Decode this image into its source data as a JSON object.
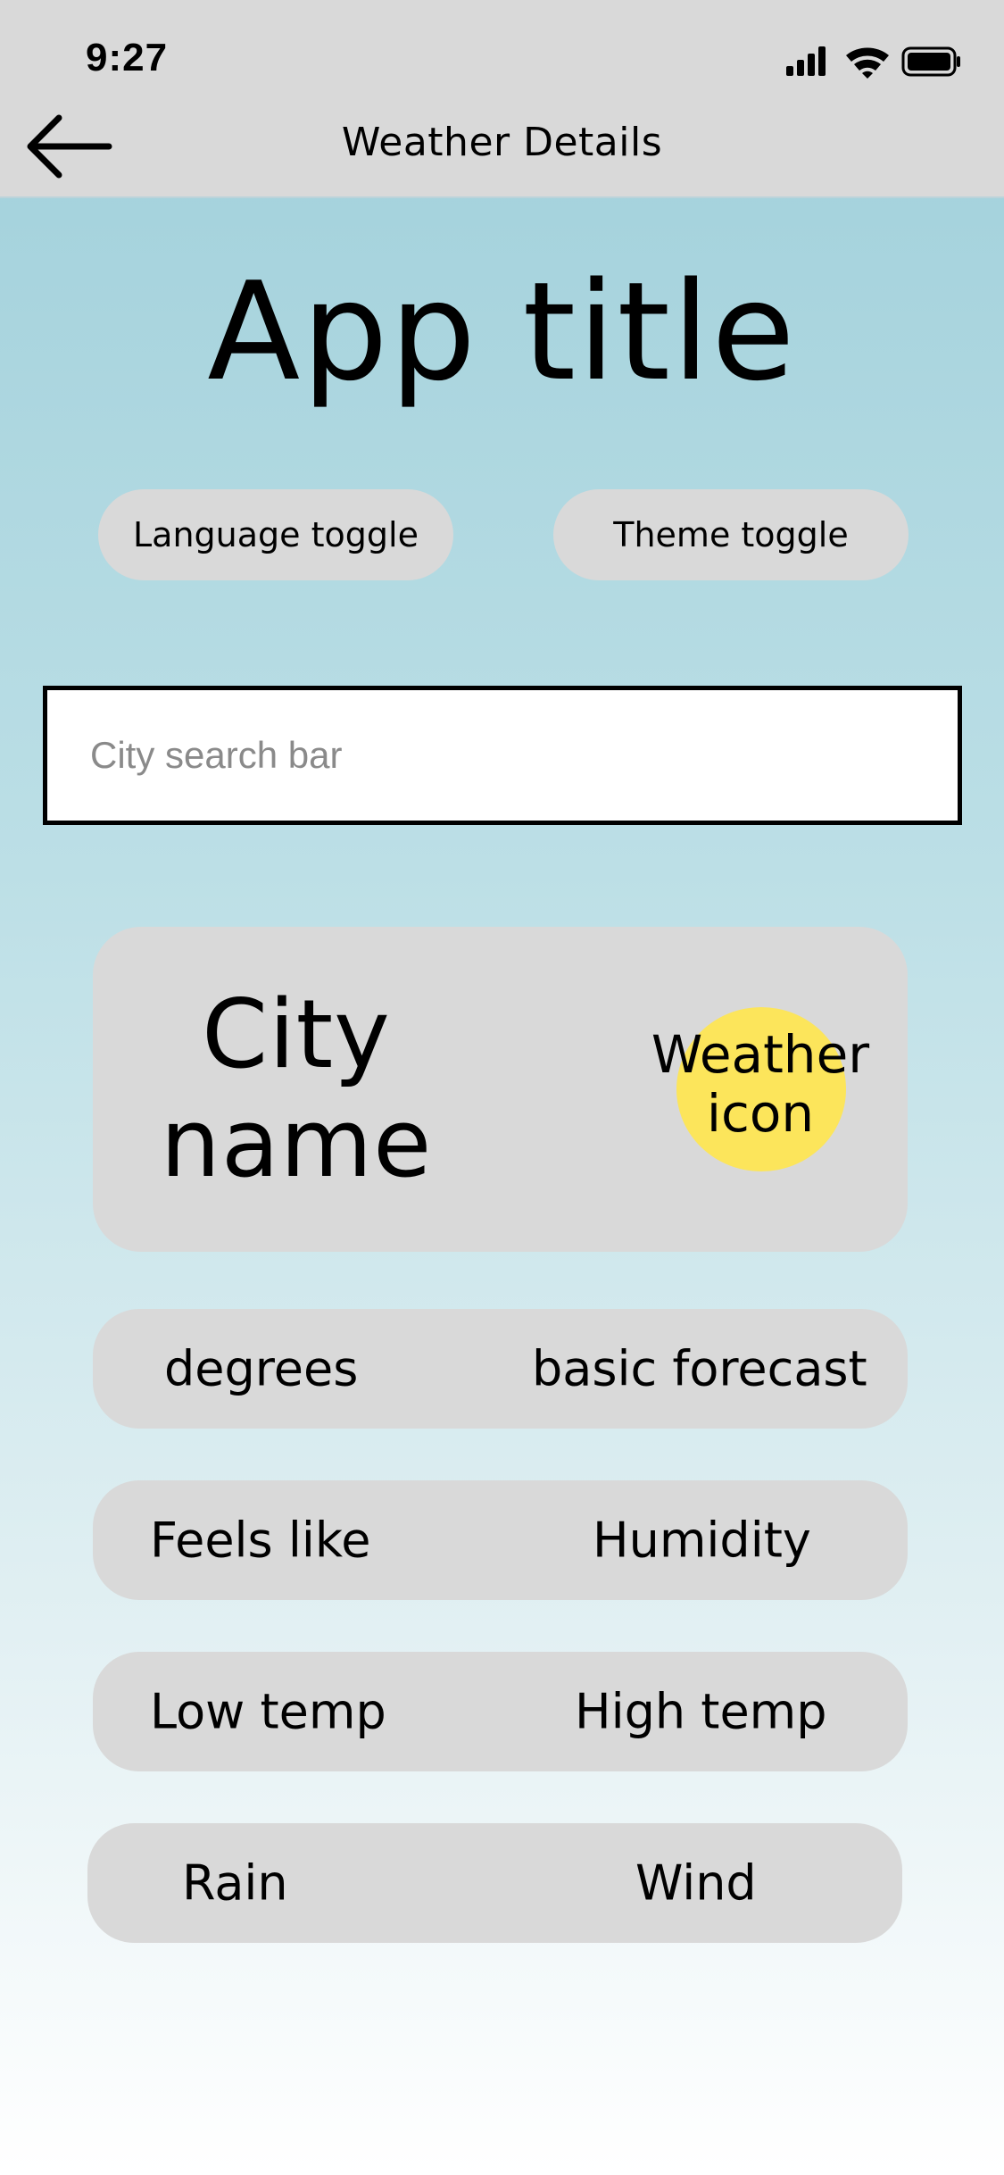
{
  "status_bar": {
    "time": "9:27"
  },
  "nav": {
    "title": "Weather Details"
  },
  "app_title": "App title",
  "toggles": {
    "language": "Language toggle",
    "theme": "Theme toggle"
  },
  "search": {
    "placeholder": "City search bar",
    "value": ""
  },
  "city_card": {
    "city_line1": "City",
    "city_line2": "name",
    "icon_line1": "Weather",
    "icon_line2": "icon"
  },
  "rows": [
    {
      "left": "degrees",
      "right": "basic forecast"
    },
    {
      "left": "Feels like",
      "right": "Humidity"
    },
    {
      "left": "Low temp",
      "right": "High temp"
    },
    {
      "left": "Rain",
      "right": "Wind"
    }
  ],
  "colors": {
    "nav_bg": "#d9d9d9",
    "card_bg": "#d9d9d9",
    "sun": "#fce55b",
    "gradient_top": "#9fcfda",
    "gradient_bottom": "#ffffff"
  }
}
